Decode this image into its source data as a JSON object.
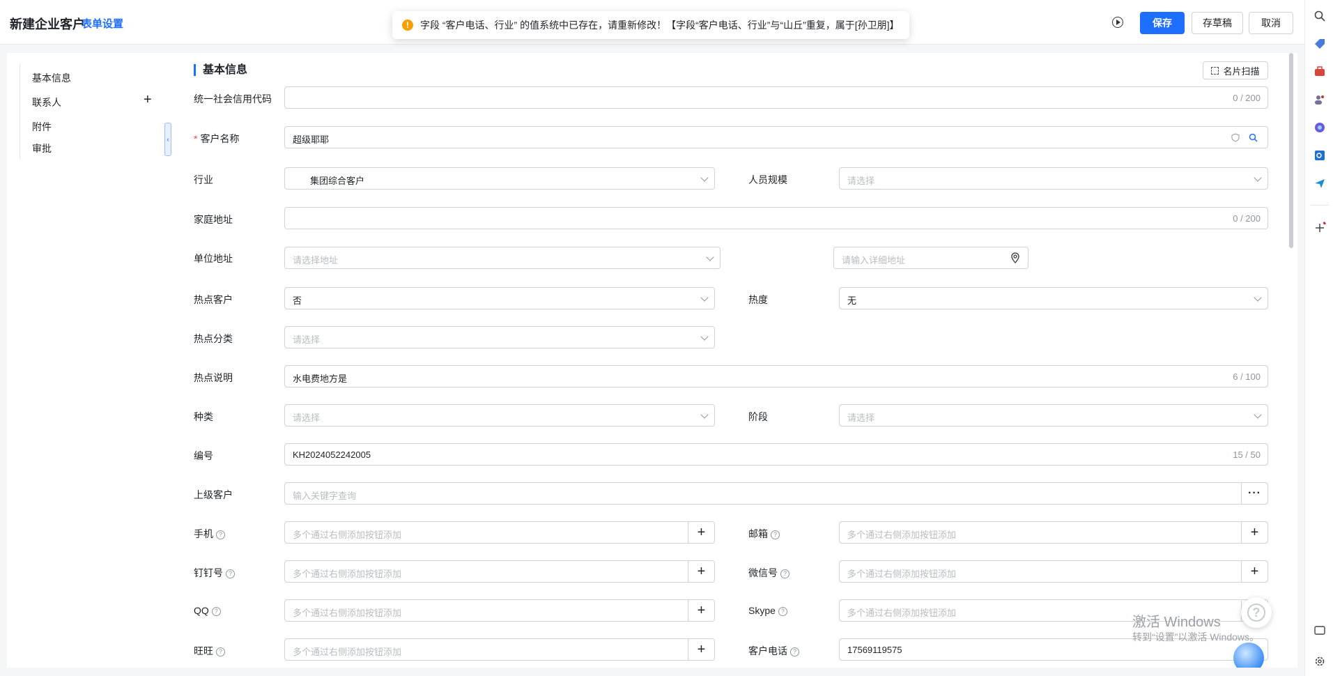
{
  "header": {
    "title": "新建企业客户",
    "form_settings": "表单设置",
    "save": "保存",
    "draft": "存草稿",
    "cancel": "取消"
  },
  "toast": {
    "message": "字段 “客户电话、行业” 的值系统中已存在，请重新修改！【字段“客户电话、行业”与“山丘”重复，属于[孙卫朋]】"
  },
  "nav": {
    "items": [
      "基本信息",
      "联系人",
      "附件",
      "审批"
    ]
  },
  "section": {
    "title": "基本信息",
    "card_scan": "名片扫描"
  },
  "fields": {
    "credit_code": {
      "label": "统一社会信用代码",
      "value": "",
      "counter": "0 / 200"
    },
    "customer_name": {
      "required": "*",
      "label": "客户名称",
      "value": "超级耶耶"
    },
    "industry": {
      "label": "行业",
      "value": "集团综合客户"
    },
    "staff_size": {
      "label": "人员规模",
      "placeholder": "请选择"
    },
    "home_address": {
      "label": "家庭地址",
      "value": "",
      "counter": "0 / 200"
    },
    "work_address": {
      "label": "单位地址",
      "placeholder": "请选择地址",
      "detail_placeholder": "请输入详细地址"
    },
    "hot_customer": {
      "label": "热点客户",
      "value": "否"
    },
    "heat": {
      "label": "热度",
      "value": "无"
    },
    "hot_category": {
      "label": "热点分类",
      "placeholder": "请选择"
    },
    "hot_desc": {
      "label": "热点说明",
      "value": "水电费地方是",
      "counter": "6 / 100"
    },
    "kind": {
      "label": "种类",
      "placeholder": "请选择"
    },
    "stage": {
      "label": "阶段",
      "placeholder": "请选择"
    },
    "number": {
      "label": "编号",
      "value": "KH2024052242005",
      "counter": "15 / 50"
    },
    "parent_customer": {
      "label": "上级客户",
      "placeholder": "输入关键字查询"
    },
    "mobile": {
      "label": "手机",
      "placeholder": "多个通过右侧添加按钮添加"
    },
    "email": {
      "label": "邮箱",
      "placeholder": "多个通过右侧添加按钮添加"
    },
    "dingtalk": {
      "label": "钉钉号",
      "placeholder": "多个通过右侧添加按钮添加"
    },
    "wechat": {
      "label": "微信号",
      "placeholder": "多个通过右侧添加按钮添加"
    },
    "qq": {
      "label": "QQ",
      "placeholder": "多个通过右侧添加按钮添加"
    },
    "skype": {
      "label": "Skype",
      "placeholder": "多个通过右侧添加按钮添加"
    },
    "wangwang": {
      "label": "旺旺",
      "placeholder": "多个通过右侧添加按钮添加"
    },
    "customer_phone": {
      "label": "客户电话",
      "value": "17569119575"
    }
  },
  "watermark": {
    "line1": "激活 Windows",
    "line2": "转到“设置”以激活 Windows。"
  },
  "colors": {
    "accent": "#1e6fff",
    "warning": "#f7a100",
    "required": "#f54a45"
  },
  "rail_icons": [
    "search-icon",
    "tag-icon",
    "briefcase-icon",
    "people-icon",
    "copilot-icon",
    "outlook-icon",
    "send-icon",
    "add-icon",
    "screenshot-icon",
    "settings-icon"
  ]
}
